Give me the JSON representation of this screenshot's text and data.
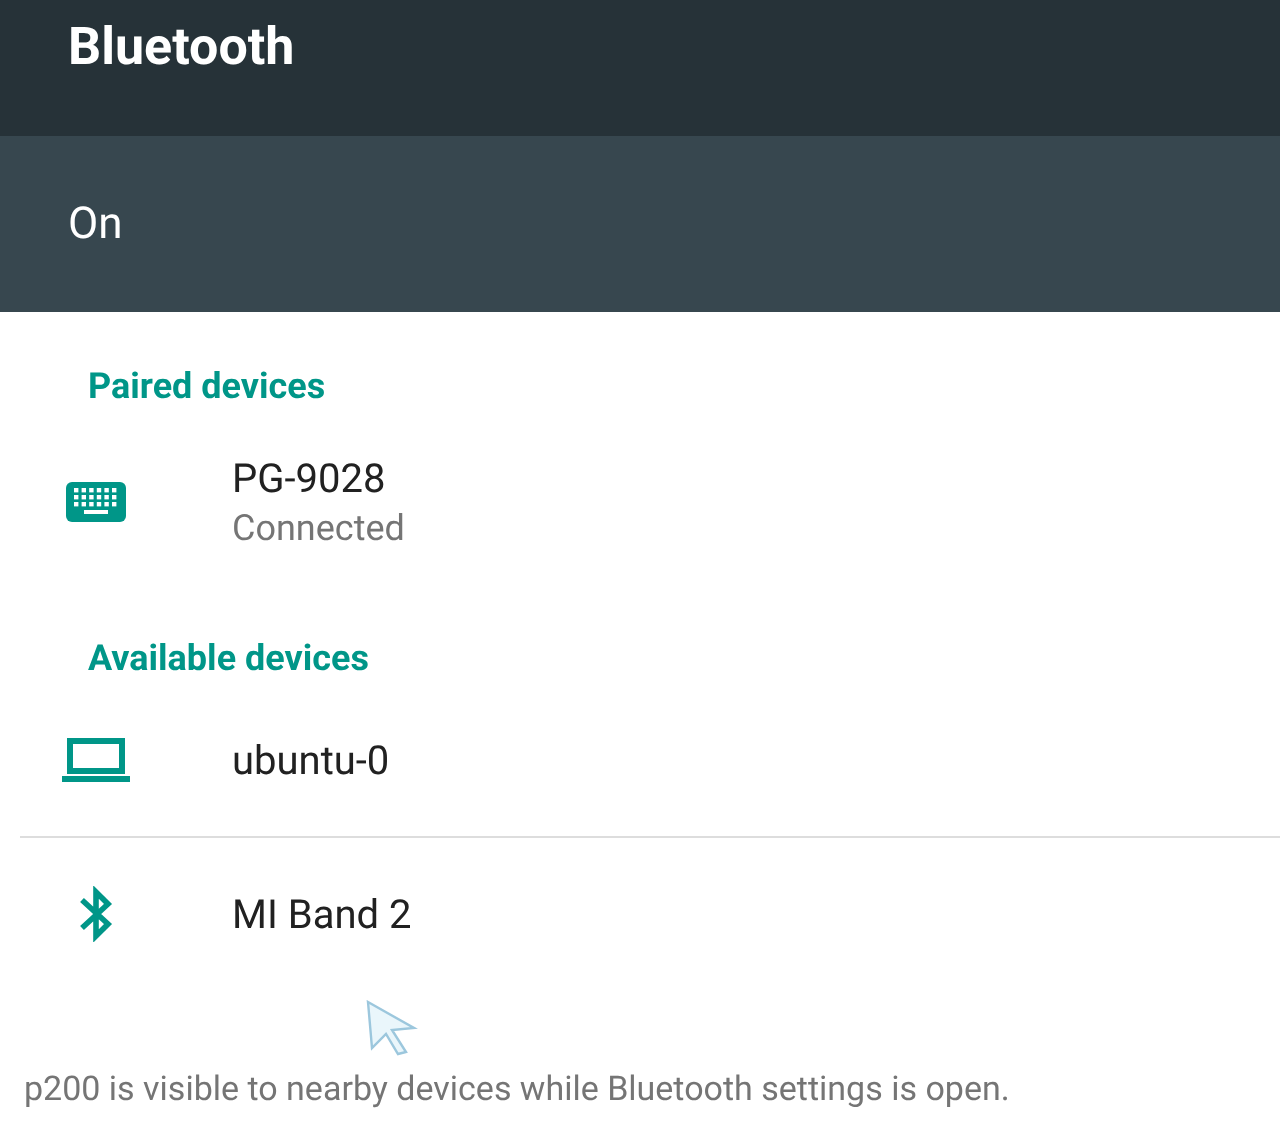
{
  "app_bar": {
    "title": "Bluetooth"
  },
  "switch_bar": {
    "label": "On",
    "on": true
  },
  "sections": [
    {
      "title": "Paired devices",
      "devices": [
        {
          "kind": "keyboard",
          "name": "PG-9028",
          "status": "Connected"
        }
      ]
    },
    {
      "title": "Available devices",
      "devices": [
        {
          "kind": "laptop",
          "name": "ubuntu-0"
        },
        {
          "kind": "bluetooth",
          "name": "MI Band 2"
        }
      ]
    }
  ],
  "footer": "p200 is visible to nearby devices while Bluetooth settings is open."
}
